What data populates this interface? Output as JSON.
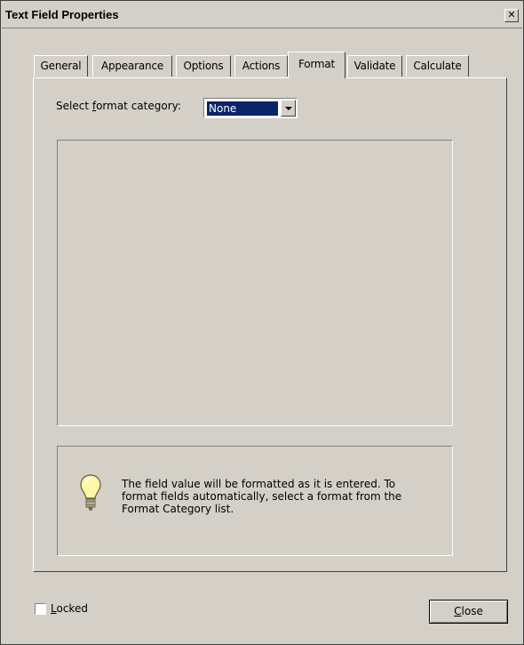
{
  "window": {
    "title": "Text Field Properties",
    "close_glyph": "✕"
  },
  "tabs": [
    {
      "label": "General",
      "active": false
    },
    {
      "label": "Appearance",
      "active": false
    },
    {
      "label": "Options",
      "active": false
    },
    {
      "label": "Actions",
      "active": false
    },
    {
      "label": "Format",
      "active": true
    },
    {
      "label": "Validate",
      "active": false
    },
    {
      "label": "Calculate",
      "active": false
    }
  ],
  "format": {
    "select_label_prefix": "Select ",
    "select_label_accel": "f",
    "select_label_suffix": "ormat category:",
    "category_value": "None",
    "info_text": "The field value will be formatted as it is entered. To format fields automatically, select a format from the Format Category list.",
    "info_icon": "lightbulb-icon"
  },
  "footer": {
    "locked_accel": "L",
    "locked_rest": "ocked",
    "locked_checked": false,
    "close_accel": "C",
    "close_rest": "lose"
  },
  "colors": {
    "dialog_bg": "#d4d0c8",
    "selection_bg": "#0a246a"
  }
}
